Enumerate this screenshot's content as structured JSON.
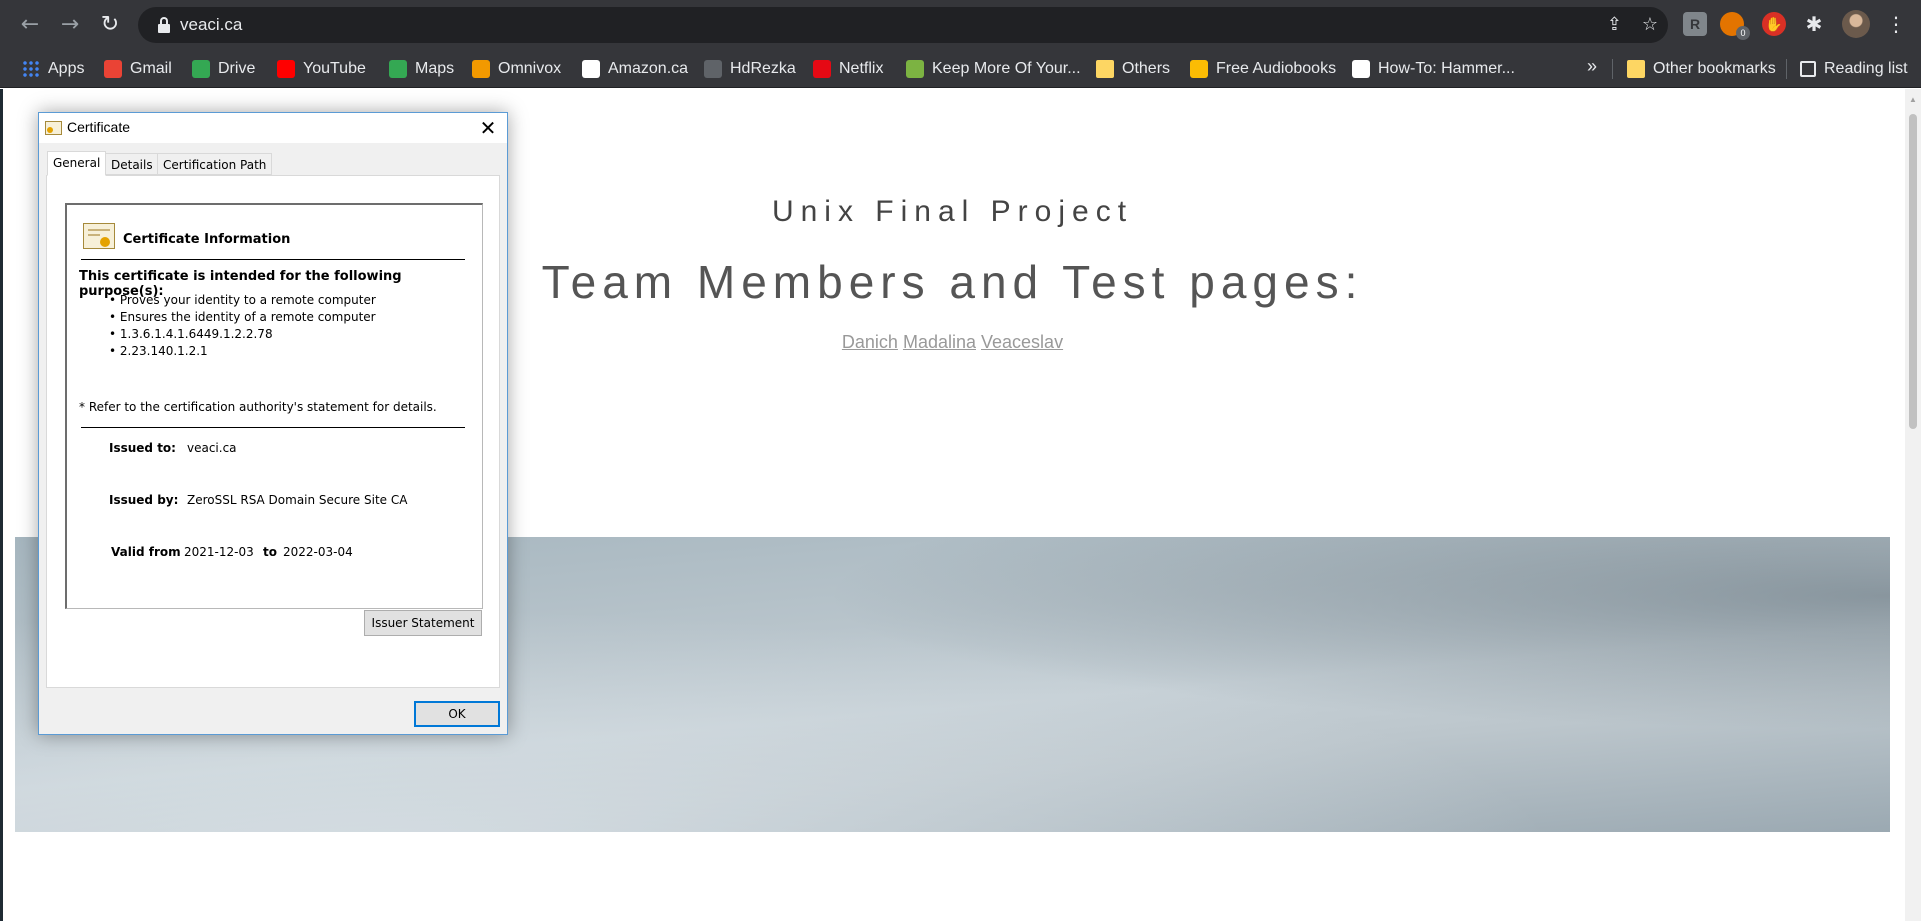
{
  "browser": {
    "url": "veaci.ca",
    "extensions": [
      {
        "name": "readlater",
        "label": "R"
      },
      {
        "name": "avast",
        "badge": "0"
      },
      {
        "name": "adblock",
        "label": "✋"
      }
    ],
    "bookmarks": [
      {
        "label": "Apps",
        "icon": "apps-grid-icon",
        "color": "#ea4335"
      },
      {
        "label": "Gmail",
        "icon": "gmail-icon",
        "color": "#ea4335"
      },
      {
        "label": "Drive",
        "icon": "drive-icon",
        "color": "#34a853"
      },
      {
        "label": "YouTube",
        "icon": "youtube-icon",
        "color": "#ff0000"
      },
      {
        "label": "Maps",
        "icon": "maps-icon",
        "color": "#34a853"
      },
      {
        "label": "Omnivox",
        "icon": "omnivox-icon",
        "color": "#f29900"
      },
      {
        "label": "Amazon.ca",
        "icon": "amazon-icon",
        "color": "#ffffff"
      },
      {
        "label": "HdRezka",
        "icon": "hdrezka-icon",
        "color": "#5f6368"
      },
      {
        "label": "Netflix",
        "icon": "netflix-icon",
        "color": "#e50914"
      },
      {
        "label": "Keep More Of Your...",
        "icon": "keepmore-icon",
        "color": "#7cb342"
      },
      {
        "label": "Others",
        "icon": "folder-icon",
        "color": "#fdd663"
      },
      {
        "label": "Free Audiobooks",
        "icon": "audiobooks-icon",
        "color": "#fbbc04"
      },
      {
        "label": "How-To: Hammer...",
        "icon": "howto-icon",
        "color": "#ffffff"
      }
    ],
    "more_label": "»",
    "other_bookmarks": "Other bookmarks",
    "reading_list": "Reading list"
  },
  "page": {
    "subtitle": "Unix Final Project",
    "title": "Team Members and Test pages:",
    "members": [
      "Danich",
      "Madalina",
      "Veaceslav"
    ]
  },
  "dialog": {
    "title": "Certificate",
    "tabs": [
      "General",
      "Details",
      "Certification Path"
    ],
    "info_title": "Certificate Information",
    "purpose_heading": "This certificate is intended for the following purpose(s):",
    "purposes": [
      "Proves your identity to a remote computer",
      "Ensures the identity of a remote computer",
      "1.3.6.1.4.1.6449.1.2.2.78",
      "2.23.140.1.2.1"
    ],
    "refer_note": "* Refer to the certification authority's statement for details.",
    "issued_to_label": "Issued to:",
    "issued_to": "veaci.ca",
    "issued_by_label": "Issued by:",
    "issued_by": "ZeroSSL RSA Domain Secure Site CA",
    "valid_from_label": "Valid from",
    "valid_from": "2021-12-03",
    "to_label": "to",
    "valid_to": "2022-03-04",
    "issuer_button": "Issuer Statement",
    "ok_button": "OK"
  }
}
